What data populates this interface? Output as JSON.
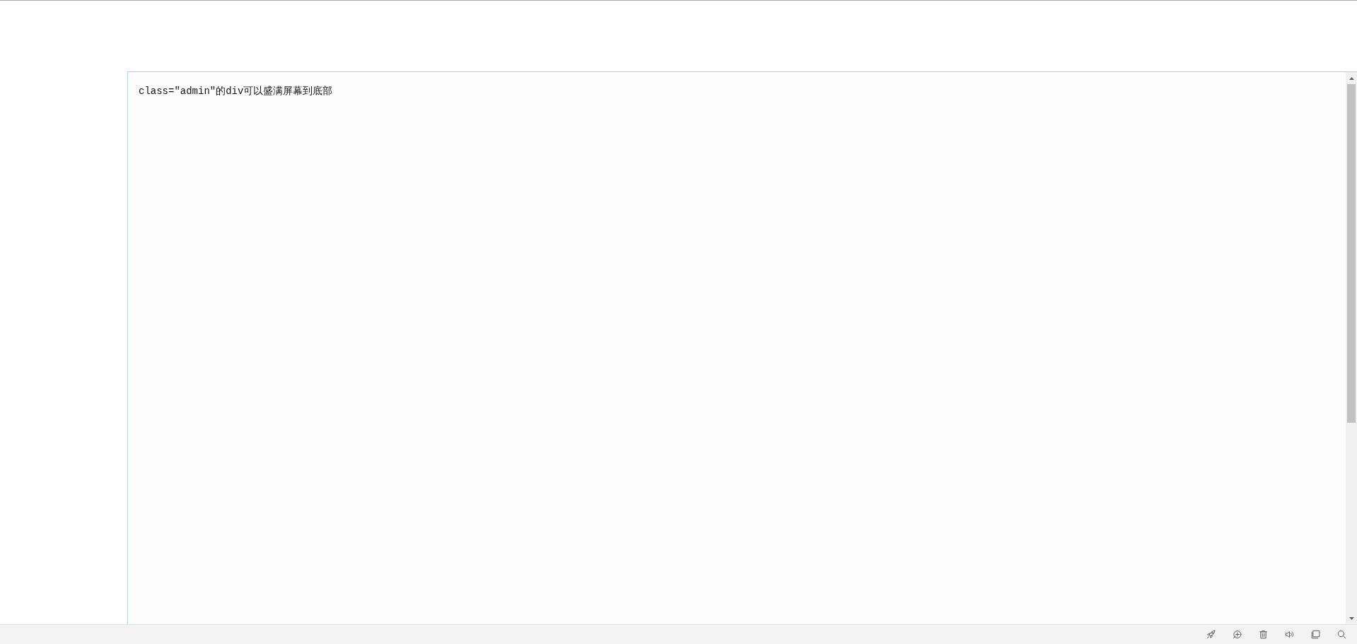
{
  "frame": {
    "text": "class=\"admin\"的div可以盛满屏幕到底部"
  }
}
